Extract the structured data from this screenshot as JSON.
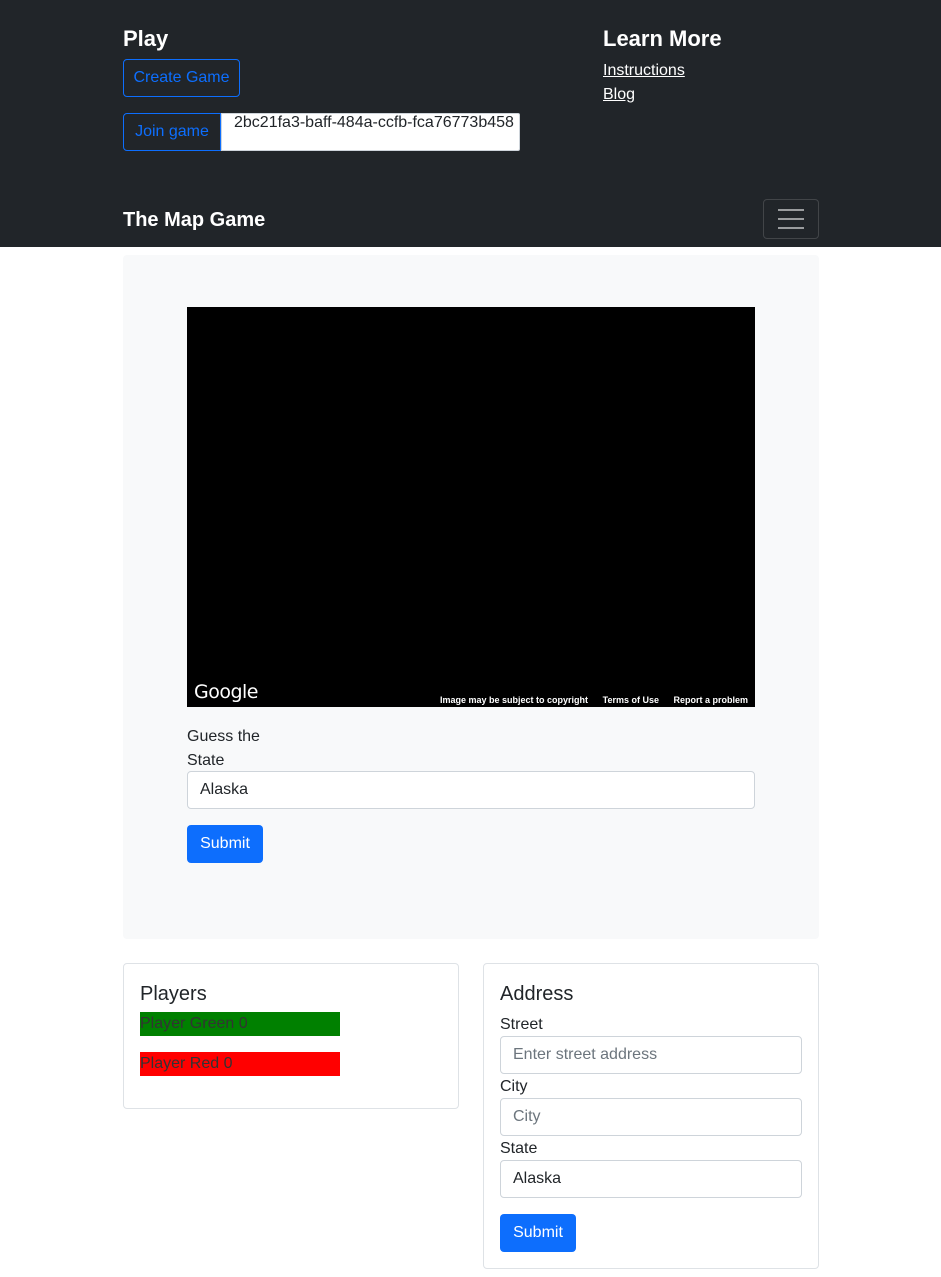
{
  "header": {
    "play_heading": "Play",
    "create_game_label": "Create Game",
    "join_game_label": "Join game",
    "game_id_value": "2bc21fa3-baff-484a-ccfb-fca76773b458",
    "learn_heading": "Learn More",
    "links": {
      "instructions": "Instructions",
      "blog": "Blog"
    }
  },
  "navbar": {
    "brand": "The Map Game",
    "toggler_icon": "hamburger-menu-icon"
  },
  "map": {
    "logo_text": "Google",
    "copyright": "Image may be subject to copyright",
    "terms": "Terms of Use",
    "report": "Report a problem"
  },
  "guess_form": {
    "label": "Guess the State",
    "value": "Alaska",
    "submit_label": "Submit"
  },
  "players": {
    "title": "Players",
    "list": [
      {
        "name": "Player Green",
        "score": "0",
        "color": "#008000",
        "text": "Player Green 0"
      },
      {
        "name": "Player Red",
        "score": "0",
        "color": "#ff0000",
        "text": "Player Red 0"
      }
    ]
  },
  "address": {
    "title": "Address",
    "street_label": "Street",
    "street_placeholder": "Enter street address",
    "city_label": "City",
    "city_placeholder": "City",
    "state_label": "State",
    "state_value": "Alaska",
    "submit_label": "Submit"
  },
  "colors": {
    "header_bg": "#212529",
    "primary": "#0d6efd",
    "panel_bg": "#f8f9fa"
  }
}
